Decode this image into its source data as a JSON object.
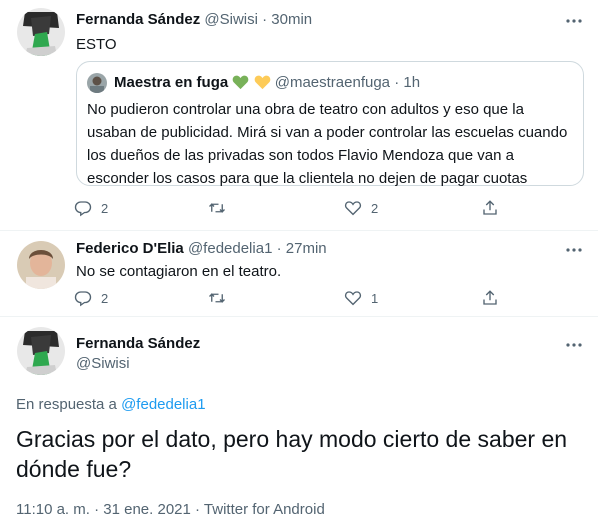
{
  "tweet1": {
    "name": "Fernanda Sández",
    "handle": "@Siwisi",
    "sep": "·",
    "time": "30min",
    "text": "ESTO",
    "quote": {
      "name": "Maestra en fuga",
      "emoji": [
        "green-heart",
        "yellow-heart"
      ],
      "handle": "@maestraenfuga",
      "sep": "·",
      "time": "1h",
      "text": "No pudieron controlar una obra de teatro con adultos y eso que la usaban de publicidad. Mirá si van a poder controlar las escuelas cuando los dueños de las privadas son todos Flavio Mendoza que van a esconder los casos para que la clientela no dejen de pagar cuotas"
    },
    "replies": "2",
    "likes": "2"
  },
  "tweet2": {
    "name": "Federico D'Elia",
    "handle": "@fededelia1",
    "sep": "·",
    "time": "27min",
    "text": "No se contagiaron en el teatro.",
    "replies": "2",
    "likes": "1"
  },
  "tweet3": {
    "name": "Fernanda Sández",
    "handle": "@Siwisi",
    "reply_prefix": "En respuesta a",
    "reply_handle": "@fededelia1",
    "text": "Gracias por el dato, pero hay modo cierto de saber en dónde fue?",
    "timestamp": "11:10 a. m. · 31 ene. 2021 · Twitter for Android"
  },
  "icons": {
    "more": "more-icon",
    "reply": "reply-icon",
    "retweet": "retweet-icon",
    "like": "like-icon",
    "share": "share-icon"
  },
  "colors": {
    "text": "#0f1419",
    "muted": "#536471",
    "link": "#1d9bf0",
    "border": "#cfd9de",
    "divider": "#eff3f4"
  }
}
